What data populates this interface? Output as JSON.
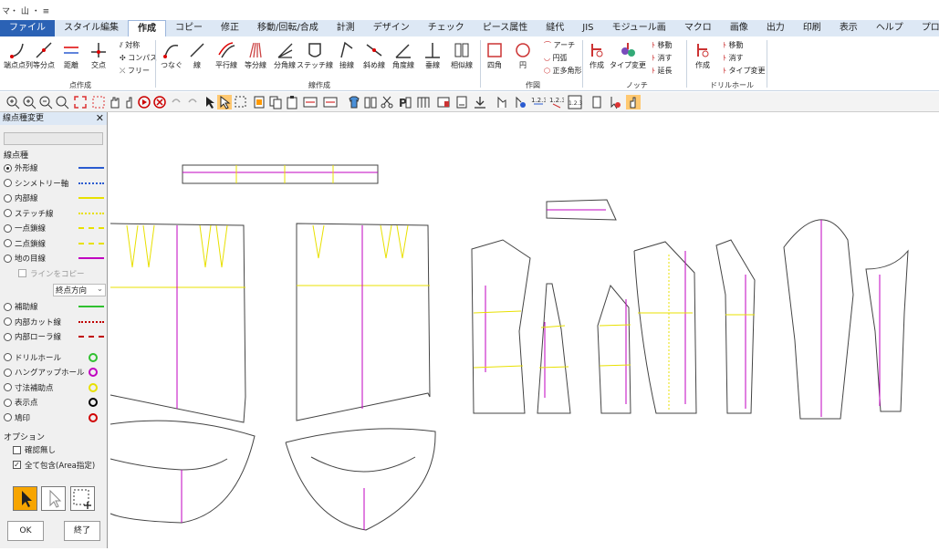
{
  "titlebar": {
    "quick_access": "マ・ 山 ・ ≡"
  },
  "menu": {
    "file": "ファイル",
    "tabs": [
      "スタイル編集",
      "作成",
      "コピー",
      "修正",
      "移動/回転/合成",
      "計測",
      "デザイン",
      "チェック",
      "ピース属性",
      "縫代",
      "JIS",
      "モジュール画",
      "マクロ",
      "画像",
      "出力",
      "印刷",
      "表示",
      "ヘルプ",
      "プロパティ"
    ],
    "active_tab": "作成"
  },
  "ribbon": {
    "points": {
      "label": "点作成",
      "buttons": [
        "端点点列",
        "等分点",
        "距離",
        "交点"
      ],
      "small": [
        "対称",
        "コンパス",
        "フリー"
      ]
    },
    "lines": {
      "label": "線作成",
      "buttons": [
        "つなぐ",
        "線",
        "平行線",
        "等分線",
        "分角線",
        "ステッチ線",
        "接線",
        "斜め線",
        "角度線",
        "垂線",
        "相似線"
      ]
    },
    "drawing": {
      "label": "作図",
      "buttons": [
        "四角",
        "円"
      ],
      "small": [
        "アーチ",
        "円弧",
        "正多角形"
      ]
    },
    "notch": {
      "label": "ノッチ",
      "buttons": [
        "作成",
        "タイプ変更"
      ],
      "small": [
        "移動",
        "消す",
        "延長"
      ]
    },
    "drill": {
      "label": "ドリルホール",
      "buttons": [
        "作成"
      ],
      "small": [
        "移動",
        "消す",
        "タイプ変更"
      ]
    }
  },
  "panel": {
    "title": "線点種変更",
    "line_section": "線点種",
    "line_types": [
      {
        "label": "外形線",
        "color": "#2a5bd0",
        "style": "solid",
        "selected": true
      },
      {
        "label": "シンメトリー軸",
        "color": "#2a5bd0",
        "style": "dotted"
      },
      {
        "label": "内部線",
        "color": "#e8e000",
        "style": "solid"
      },
      {
        "label": "ステッチ線",
        "color": "#e8e000",
        "style": "dotted"
      },
      {
        "label": "一点鎖線",
        "color": "#e8e000",
        "style": "dashed"
      },
      {
        "label": "二点鎖線",
        "color": "#e8e000",
        "style": "dashed"
      },
      {
        "label": "地の目線",
        "color": "#c000c0",
        "style": "solid"
      }
    ],
    "copy_line_label": "ラインをコピー",
    "direction_select": "終点方向",
    "extra_types": [
      {
        "label": "補助線",
        "color": "#30c030",
        "style": "solid"
      },
      {
        "label": "内部カット線",
        "color": "#c00000",
        "style": "dotted"
      },
      {
        "label": "内部ローラ線",
        "color": "#c00000",
        "style": "dashed"
      }
    ],
    "point_types": [
      {
        "label": "ドリルホール",
        "color": "#30c030"
      },
      {
        "label": "ハングアップホール",
        "color": "#c000c0"
      },
      {
        "label": "寸法補助点",
        "color": "#e8e000"
      },
      {
        "label": "表示点",
        "color": "#000000"
      },
      {
        "label": "鳩印",
        "color": "#d00000"
      }
    ],
    "options_label": "オプション",
    "no_confirm": "確認無し",
    "include_all": "全て包含(Area指定)",
    "ok": "OK",
    "exit": "終了"
  }
}
